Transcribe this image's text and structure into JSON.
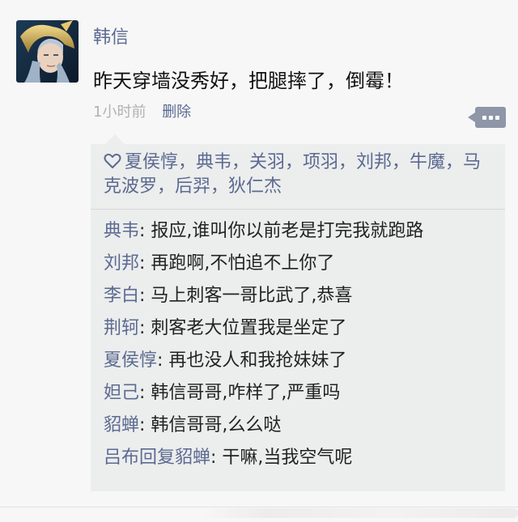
{
  "post": {
    "author": "韩信",
    "content": "昨天穿墙没秀好，把腿摔了，倒霉！",
    "time": "1小时前",
    "delete_label": "删除"
  },
  "likes": {
    "icon": "heart-outline-icon",
    "names": "夏侯惇，典韦，关羽，项羽，刘邦，牛魔，马克波罗，后羿，狄仁杰"
  },
  "comments": [
    {
      "who": "典韦",
      "text": ": 报应,谁叫你以前老是打完我就跑路"
    },
    {
      "who": "刘邦",
      "text": ": 再跑啊,不怕追不上你了"
    },
    {
      "who": "李白",
      "text": ": 马上刺客一哥比武了,恭喜"
    },
    {
      "who": "荆轲",
      "text": ": 刺客老大位置我是坐定了"
    },
    {
      "who": "夏侯惇",
      "text": ": 再也没人和我抢妹妹了"
    },
    {
      "who": "妲己",
      "text": ": 韩信哥哥,咋样了,严重吗"
    },
    {
      "who": "貂蝉",
      "text": ": 韩信哥哥,么么哒"
    },
    {
      "who": "吕布回复貂蝉",
      "text": ": 干嘛,当我空气呢"
    }
  ],
  "colors": {
    "link": "#5b6a91",
    "panel_bg": "#eceded",
    "page_bg": "#f7f7f7",
    "muted": "#b2b2b2"
  }
}
